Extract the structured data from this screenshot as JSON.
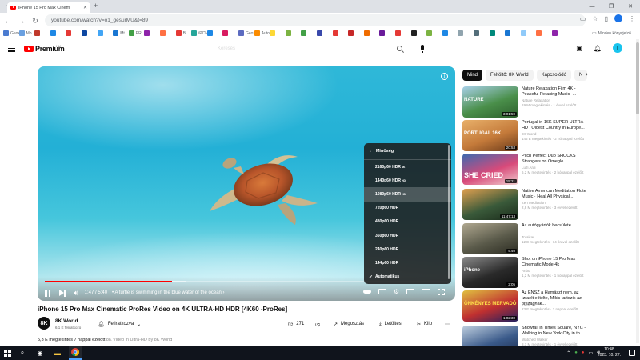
{
  "browser": {
    "tab_title": "iPhone 15 Pro Max Cinem",
    "url": "youtube.com/watch?v=o1_gesurMU&t=89",
    "bookmarks_tail": "Minden könyvjelző",
    "bookmarks": [
      {
        "label": "Geox",
        "color": "#4a7bd0"
      },
      {
        "label": "Mb",
        "color": "#6aa0e0"
      },
      {
        "label": "",
        "color": "#c0392b"
      },
      {
        "label": "",
        "color": "#1e88e5"
      },
      {
        "label": "",
        "color": "#e53935"
      },
      {
        "label": "",
        "color": "#0d47a1"
      },
      {
        "label": "",
        "color": "#42a5f5"
      },
      {
        "label": "Mt",
        "color": "#1976d2"
      },
      {
        "label": "PRI",
        "color": "#43a047"
      },
      {
        "label": "",
        "color": "#8e24aa"
      },
      {
        "label": "",
        "color": "#ff7043"
      },
      {
        "label": "B",
        "color": "#e53935"
      },
      {
        "label": "iPCM",
        "color": "#26a69a"
      },
      {
        "label": "",
        "color": "#1e88e5"
      },
      {
        "label": "",
        "color": "#d81b60"
      },
      {
        "label": "Geox",
        "color": "#5c6bc0"
      },
      {
        "label": "Auto",
        "color": "#fb8c00"
      },
      {
        "label": "",
        "color": "#fdd835"
      },
      {
        "label": "",
        "color": "#7cb342"
      },
      {
        "label": "",
        "color": "#43a047"
      },
      {
        "label": "",
        "color": "#3949ab"
      },
      {
        "label": "",
        "color": "#e53935"
      },
      {
        "label": "",
        "color": "#c62828"
      },
      {
        "label": "",
        "color": "#ef6c00"
      },
      {
        "label": "",
        "color": "#6a1b9a"
      },
      {
        "label": "",
        "color": "#e53935"
      },
      {
        "label": "",
        "color": "#212121"
      },
      {
        "label": "",
        "color": "#7cb342"
      },
      {
        "label": "",
        "color": "#1e88e5"
      },
      {
        "label": "",
        "color": "#90a4ae"
      },
      {
        "label": "",
        "color": "#546e7a"
      },
      {
        "label": "",
        "color": "#00897b"
      },
      {
        "label": "",
        "color": "#1976d2"
      },
      {
        "label": "",
        "color": "#90caf9"
      },
      {
        "label": "",
        "color": "#ff7043"
      },
      {
        "label": "",
        "color": "#8e24aa"
      }
    ]
  },
  "youtube": {
    "logo_text": "Premium",
    "logo_cc": "HU",
    "search_placeholder": "Keresés",
    "avatar_letter": "T"
  },
  "player": {
    "time": "1:47 / 5:40",
    "chapter": "• A turtle is swimming in the blue water of the ocean ›",
    "progress_fraction": 0.315,
    "buffered_fraction": 0.35,
    "quality_menu": {
      "header": "Minőség",
      "items": [
        {
          "label": "2160p60 HDR",
          "badge": "4K",
          "selected": false
        },
        {
          "label": "1440p60 HDR",
          "badge": "HD",
          "selected": false
        },
        {
          "label": "1080p60 HDR",
          "badge": "HD",
          "selected": true
        },
        {
          "label": "720p60 HDR",
          "badge": "",
          "selected": false
        },
        {
          "label": "480p60 HDR",
          "badge": "",
          "selected": false
        },
        {
          "label": "360p60 HDR",
          "badge": "",
          "selected": false
        },
        {
          "label": "240p60 HDR",
          "badge": "",
          "selected": false
        },
        {
          "label": "144p60 HDR",
          "badge": "",
          "selected": false
        },
        {
          "label": "Automatikus",
          "badge": "",
          "selected": false,
          "checked": true
        }
      ]
    }
  },
  "video": {
    "title": "iPhone 15 Pro Max Cinematic ProRes Video on 4K ULTRA-HD HDR [4K60 -ProRes]",
    "channel": "8K World",
    "channel_avatar": "8K",
    "subscribers": "6,1 E feliratkozó",
    "subscribe_label": "Feliratkozva",
    "likes": "271",
    "share_label": "Megosztás",
    "download_label": "Letöltés",
    "clip_label": "Klip",
    "views_line": "5,3 E megtekintés  7 nappal ezelőtt",
    "desc_tags": "  8K Video in Ultra-HD by 8K World"
  },
  "sidebar": {
    "chips": [
      "Mind",
      "Feltöltő: 8K World",
      "Kapcsolódó",
      "N"
    ],
    "items": [
      {
        "title": "Nature Relaxation Film 4K - Peaceful Relaxing Music -...",
        "channel": "Nature Relaxation",
        "meta": "19 M megtekintés · 1 évvel ezelőtt",
        "duration": "3:01:59",
        "colors": [
          "#4a8f4a",
          "#a8d0e8",
          "#2c5e2c"
        ],
        "text": "NATURE"
      },
      {
        "title": "Portugal in 16K SUPER ULTRA-HD | Oldest Country in Europe...",
        "channel": "8K World",
        "meta": "145 E megtekintés · 2 hónappal ezelőtt",
        "duration": "20:53",
        "colors": [
          "#c47a3a",
          "#e8b06a",
          "#6a3a1a"
        ],
        "text": "PORTUGAL 16K"
      },
      {
        "title": "Pitch Perfect Duo SHOCKS Strangers on Omegle",
        "channel": "Lutfi Ardi",
        "meta": "6,2 M megtekintés · 2 hónappal ezelőtt",
        "duration": "15:21",
        "colors": [
          "#d84a7a",
          "#3a6ab0",
          "#f0d0d0"
        ],
        "text": "SHE CRIED"
      },
      {
        "title": "Native American Meditation Flute Music · Heal All Physical...",
        "channel": "Zen Meditation",
        "meta": "2,8 M megtekintés · 3 évvel ezelőtt",
        "duration": "11:47:13",
        "colors": [
          "#3a5a3a",
          "#e0a050",
          "#1a2a1a"
        ],
        "text": ""
      },
      {
        "title": "Az autógyártók becsülete",
        "channel": "Totalcar",
        "meta": "12 E megtekintés · 14 órával ezelőtt",
        "duration": "9:40",
        "colors": [
          "#5a5a4a",
          "#b0a890",
          "#2a2a20"
        ],
        "text": ""
      },
      {
        "title": "Shot on iPhone 15 Pro Max Cinematic Mode 4k",
        "channel": "Anbu",
        "meta": "1,2 M megtekintés · 1 hónappal ezelőtt",
        "duration": "2:05",
        "colors": [
          "#2a2a2a",
          "#8a8a8a",
          "#101010"
        ],
        "text": "iPhone"
      },
      {
        "title": "Az ENSZ a Hamászt nem, az Izraelt elítélte, Mikis tartozik az országnak...",
        "channel": "Indító TV",
        "meta": "23 E megtekintés · 1 nappal ezelőtt",
        "duration": "1:02:30",
        "colors": [
          "#c03030",
          "#e0c040",
          "#202060"
        ],
        "text": "ÖNKÉNYES MERVADÓ"
      },
      {
        "title": "Snowfall in Times Square, NYC - Walking in New York City in th...",
        "channel": "Watched Walker",
        "meta": "8,1 M megtekintés · 1 évvel ezelőtt",
        "duration": "",
        "colors": [
          "#3a5a8a",
          "#c0d0e0",
          "#1a2a4a"
        ],
        "text": ""
      }
    ]
  },
  "taskbar": {
    "time": "10:48",
    "date": "2023. 10. 27."
  }
}
